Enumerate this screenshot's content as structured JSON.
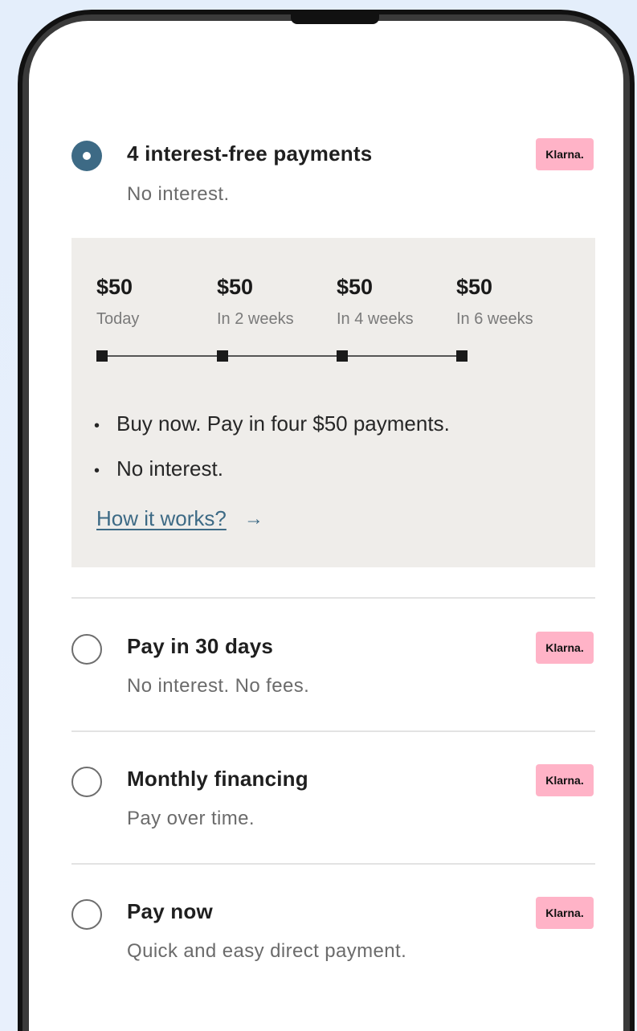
{
  "options": [
    {
      "title": "4 interest-free payments",
      "subtitle": "No interest.",
      "badge": "Klarna.",
      "selected": true
    },
    {
      "title": "Pay in 30 days",
      "subtitle": "No interest. No fees.",
      "badge": "Klarna.",
      "selected": false
    },
    {
      "title": "Monthly financing",
      "subtitle": "Pay over time.",
      "badge": "Klarna.",
      "selected": false
    },
    {
      "title": "Pay now",
      "subtitle": "Quick and easy direct payment.",
      "badge": "Klarna.",
      "selected": false
    }
  ],
  "schedule": [
    {
      "amount": "$50",
      "when": "Today"
    },
    {
      "amount": "$50",
      "when": "In 2 weeks"
    },
    {
      "amount": "$50",
      "when": "In 4 weeks"
    },
    {
      "amount": "$50",
      "when": "In 6 weeks"
    }
  ],
  "bullets": [
    "Buy now. Pay in four $50 payments.",
    "No interest."
  ],
  "bullet_mark": "•",
  "link": {
    "label": "How it works?",
    "arrow": "→"
  },
  "colors": {
    "accent": "#3d6a85",
    "badge": "#ffb3c7",
    "panel": "#efedea"
  }
}
